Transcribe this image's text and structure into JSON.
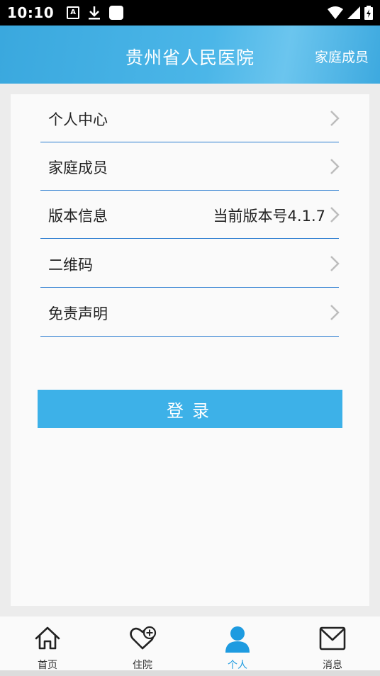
{
  "status_bar": {
    "time": "10:10",
    "a_icon_text": "A"
  },
  "header": {
    "title": "贵州省人民医院",
    "action": "家庭成员"
  },
  "menu": [
    {
      "label": "个人中心",
      "value": ""
    },
    {
      "label": "家庭成员",
      "value": ""
    },
    {
      "label": "版本信息",
      "value": "当前版本号4.1.7"
    },
    {
      "label": "二维码",
      "value": ""
    },
    {
      "label": "免责声明",
      "value": ""
    }
  ],
  "login_button": "登录",
  "bottom_nav": [
    {
      "label": "首页",
      "icon": "home-icon"
    },
    {
      "label": "住院",
      "icon": "heart-plus-icon"
    },
    {
      "label": "个人",
      "icon": "person-icon",
      "active": true
    },
    {
      "label": "消息",
      "icon": "mail-icon"
    }
  ],
  "colors": {
    "accent": "#3db1e8",
    "divider": "#2a7cd0",
    "active_nav": "#1e9be0"
  }
}
